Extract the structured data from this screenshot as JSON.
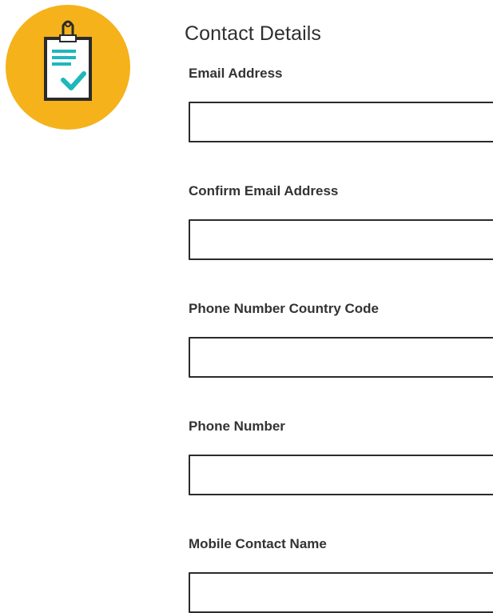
{
  "page": {
    "icon": "clipboard-checklist-icon",
    "badge_color": "#F5B21A",
    "accent_color": "#1FB7BD"
  },
  "form": {
    "title": "Contact Details",
    "fields": [
      {
        "label": "Email Address",
        "value": "",
        "placeholder": ""
      },
      {
        "label": "Confirm Email Address",
        "value": "",
        "placeholder": ""
      },
      {
        "label": "Phone Number Country Code",
        "value": "",
        "placeholder": ""
      },
      {
        "label": "Phone Number",
        "value": "",
        "placeholder": ""
      },
      {
        "label": "Mobile Contact Name",
        "value": "",
        "placeholder": ""
      }
    ]
  }
}
